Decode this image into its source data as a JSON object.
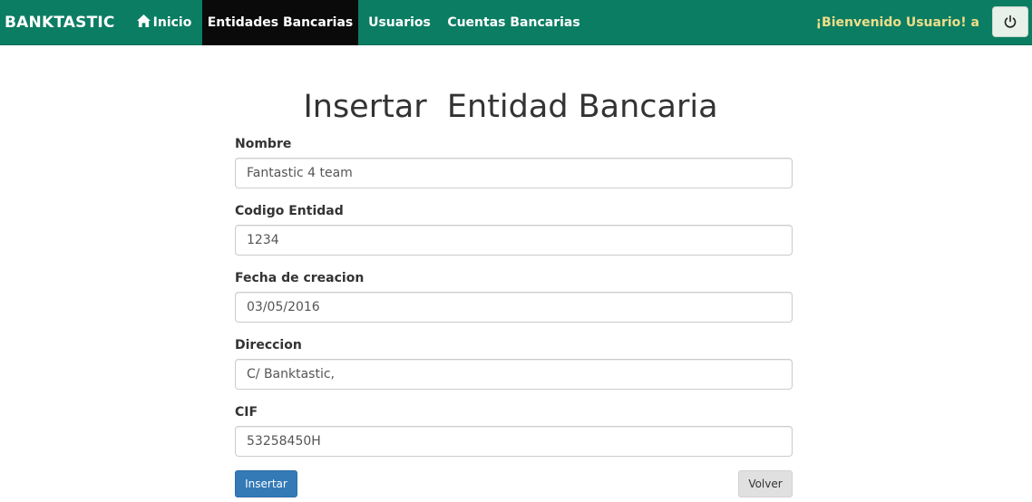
{
  "navbar": {
    "brand": "BANKTASTIC",
    "items": [
      {
        "label": "Inicio",
        "icon": "home-icon"
      },
      {
        "label": "Entidades Bancarias",
        "active": true
      },
      {
        "label": "Usuarios"
      },
      {
        "label": "Cuentas Bancarias"
      }
    ],
    "welcome": "¡Bienvenido Usuario! a",
    "logout_icon": "power-icon",
    "colors": {
      "bar": "#0b7d63",
      "active": "#0a0a0a",
      "welcome": "#f0de8a"
    }
  },
  "form": {
    "title": "Insertar  Entidad Bancaria",
    "fields": [
      {
        "label": "Nombre",
        "value": "Fantastic 4 team"
      },
      {
        "label": "Codigo Entidad",
        "value": "1234"
      },
      {
        "label": "Fecha de creacion",
        "value": "03/05/2016"
      },
      {
        "label": "Direccion",
        "value": "C/ Banktastic,"
      },
      {
        "label": "CIF",
        "value": "53258450H"
      }
    ],
    "submit_label": "Insertar",
    "back_label": "Volver",
    "colors": {
      "primary": "#337ab7",
      "secondary": "#e0e0e0"
    }
  }
}
